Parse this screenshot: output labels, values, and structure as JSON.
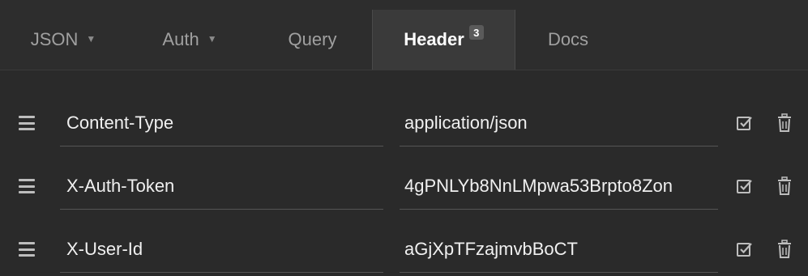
{
  "tabs": [
    {
      "label": "JSON",
      "has_caret": true,
      "active": false
    },
    {
      "label": "Auth",
      "has_caret": true,
      "active": false
    },
    {
      "label": "Query",
      "has_caret": false,
      "active": false
    },
    {
      "label": "Header",
      "has_caret": false,
      "active": true,
      "badge": "3"
    },
    {
      "label": "Docs",
      "has_caret": false,
      "active": false
    }
  ],
  "headers": [
    {
      "name": "Content-Type",
      "value": "application/json",
      "enabled": true
    },
    {
      "name": "X-Auth-Token",
      "value": "4gPNLYb8NnLMpwa53Brpto8Zon",
      "enabled": true
    },
    {
      "name": "X-User-Id",
      "value": "aGjXpTFzajmvbBoCT",
      "enabled": true
    }
  ],
  "icons": {
    "tab_caret": "caret-down-icon",
    "row_handle": "drag-handle-icon",
    "row_toggle": "checkbox-checked-icon",
    "row_delete": "trash-icon"
  },
  "colors": {
    "background": "#2a2a2a",
    "active_tab": "#3a3a3a",
    "text": "#e6e6e6",
    "muted_text": "#a0a0a0"
  }
}
